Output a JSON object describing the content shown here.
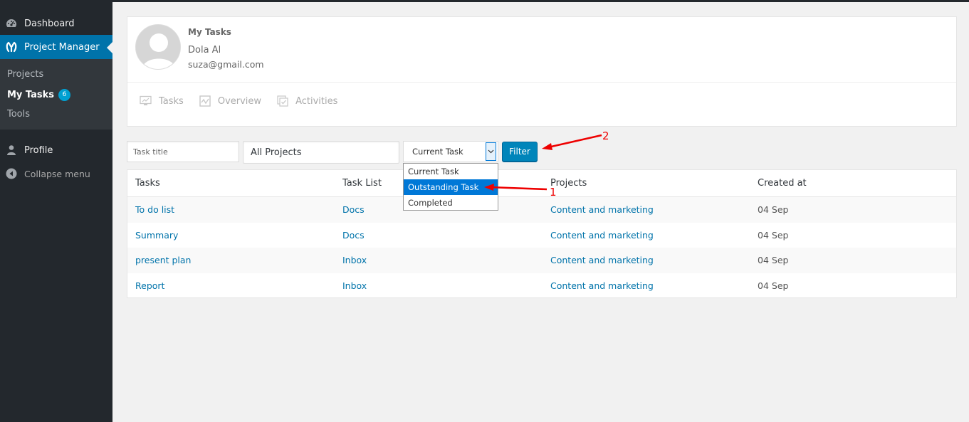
{
  "sidebar": {
    "dashboard": "Dashboard",
    "project_manager": "Project Manager",
    "submenu": {
      "projects": "Projects",
      "my_tasks": "My Tasks",
      "my_tasks_badge": "6",
      "tools": "Tools"
    },
    "profile": "Profile",
    "collapse": "Collapse menu"
  },
  "header": {
    "title": "My Tasks",
    "user_name": "Dola Al",
    "user_email": "suza@gmail.com",
    "tabs": [
      {
        "label": "Tasks",
        "icon": "monitor-chart-icon"
      },
      {
        "label": "Overview",
        "icon": "line-chart-icon"
      },
      {
        "label": "Activities",
        "icon": "checkbox-stack-icon"
      }
    ]
  },
  "filters": {
    "task_title_placeholder": "Task title",
    "project_select": "All Projects",
    "status_select": "Current Task",
    "status_options": [
      "Current Task",
      "Outstanding Task",
      "Completed"
    ],
    "status_highlighted": "Outstanding Task",
    "filter_button": "Filter"
  },
  "table": {
    "columns": [
      "Tasks",
      "Task List",
      "Projects",
      "Created at"
    ],
    "rows": [
      {
        "task": "To do list",
        "list": "Docs",
        "project": "Content and marketing",
        "created": "04 Sep"
      },
      {
        "task": "Summary",
        "list": "Docs",
        "project": "Content and marketing",
        "created": "04 Sep"
      },
      {
        "task": "present plan",
        "list": "Inbox",
        "project": "Content and marketing",
        "created": "04 Sep"
      },
      {
        "task": "Report",
        "list": "Inbox",
        "project": "Content and marketing",
        "created": "04 Sep"
      }
    ]
  },
  "annotations": {
    "step1": "1",
    "step2": "2",
    "color": "#e00000"
  }
}
